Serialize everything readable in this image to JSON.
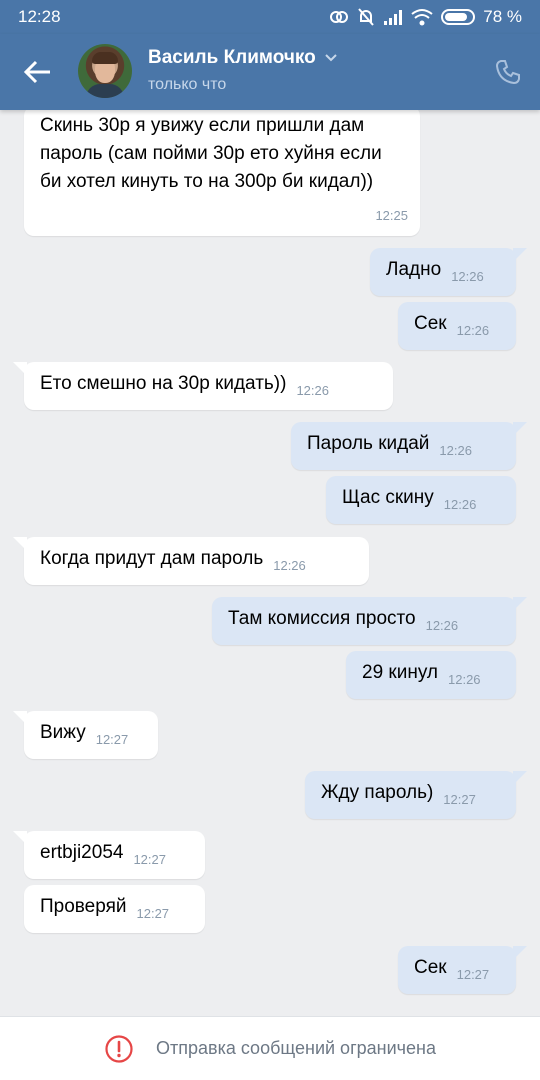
{
  "status_bar": {
    "time": "12:28",
    "battery": "78 %"
  },
  "header": {
    "name": "Василь Климочко",
    "status": "только что"
  },
  "messages": [
    {
      "dir": "in",
      "text": "Скинь 30р я увижу если пришли дам пароль (сам пойми 30р ето хуйня если би хотел кинуть то на 300р би кидал))",
      "time": "12:25"
    },
    {
      "dir": "out",
      "text": "Ладно",
      "time": "12:26"
    },
    {
      "dir": "out",
      "text": "Сек",
      "time": "12:26"
    },
    {
      "dir": "in",
      "text": "Ето смешно на 30р кидать))",
      "time": "12:26"
    },
    {
      "dir": "out",
      "text": "Пароль кидай",
      "time": "12:26"
    },
    {
      "dir": "out",
      "text": "Щас скину",
      "time": "12:26"
    },
    {
      "dir": "in",
      "text": "Когда придут дам пароль",
      "time": "12:26"
    },
    {
      "dir": "out",
      "text": "Там комиссия просто",
      "time": "12:26"
    },
    {
      "dir": "out",
      "text": "29 кинул",
      "time": "12:26"
    },
    {
      "dir": "in",
      "text": "Вижу",
      "time": "12:27"
    },
    {
      "dir": "out",
      "text": "Жду пароль)",
      "time": "12:27"
    },
    {
      "dir": "in",
      "text": "ertbji2054",
      "time": "12:27"
    },
    {
      "dir": "in",
      "text": "Проверяй",
      "time": "12:27"
    },
    {
      "dir": "out",
      "text": "Сек",
      "time": "12:27"
    }
  ],
  "footer": {
    "notice": "Отправка сообщений ограничена"
  },
  "colors": {
    "header": "#4a76a8",
    "incoming": "#ffffff",
    "outgoing": "#dbe6f5",
    "background": "#edeef0",
    "warning": "#e64646"
  }
}
